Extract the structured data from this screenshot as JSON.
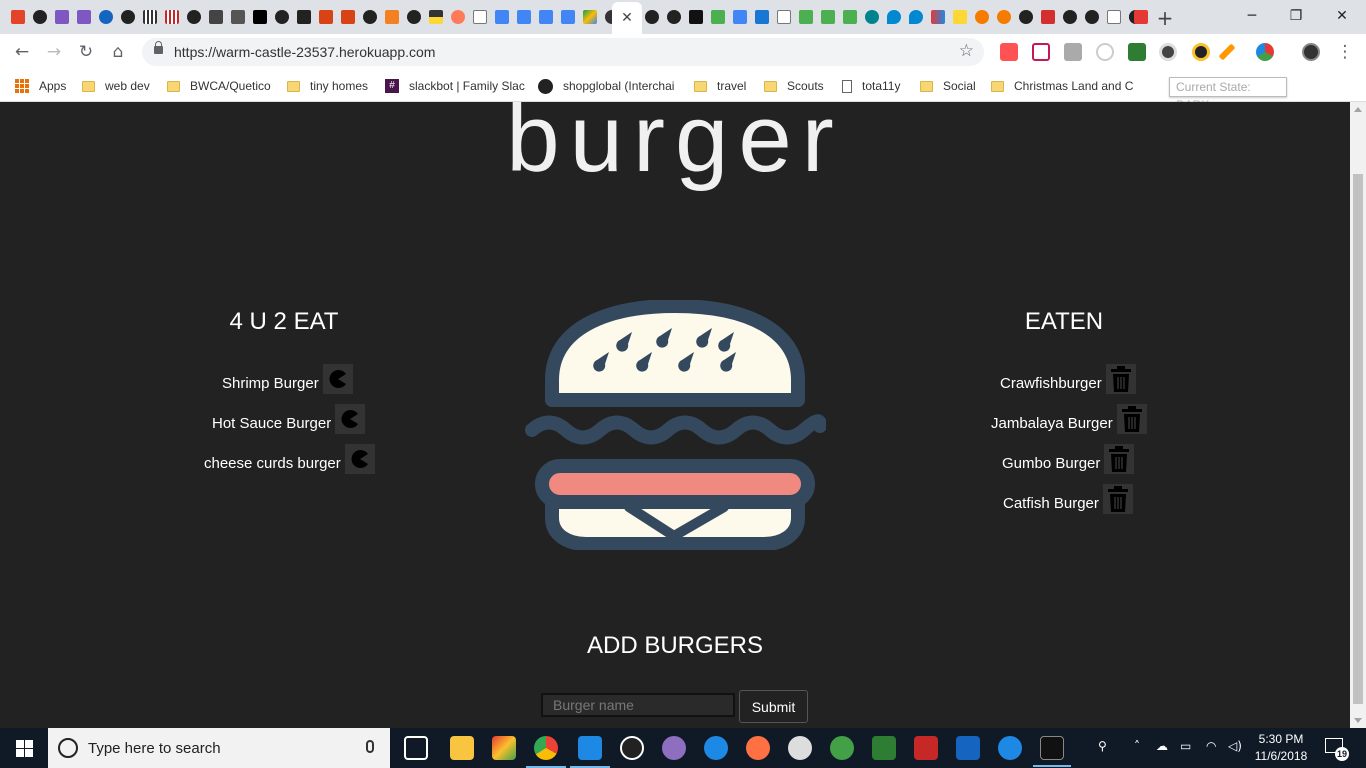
{
  "browser": {
    "url": "https://warm-castle-23537.herokuapp.com",
    "tooltip": "Current State: DARK",
    "bookmarks": [
      {
        "label": "Apps",
        "icon": "apps-icon"
      },
      {
        "label": "web dev",
        "icon": "folder-icon"
      },
      {
        "label": "BWCA/Quetico",
        "icon": "folder-icon"
      },
      {
        "label": "tiny homes",
        "icon": "folder-icon"
      },
      {
        "label": "slackbot | Family Slac",
        "icon": "slack-icon"
      },
      {
        "label": "shopglobal (Interchai",
        "icon": "github-icon"
      },
      {
        "label": "travel",
        "icon": "folder-icon"
      },
      {
        "label": "Scouts",
        "icon": "folder-icon"
      },
      {
        "label": "tota11y",
        "icon": "page-icon"
      },
      {
        "label": "Social",
        "icon": "folder-icon"
      },
      {
        "label": "Christmas Land and C",
        "icon": "folder-icon"
      }
    ]
  },
  "page": {
    "title": "burger",
    "to_eat": {
      "heading": "4 U 2 EAT",
      "items": [
        "Shrimp Burger",
        "Hot Sauce Burger",
        "cheese curds burger"
      ]
    },
    "eaten": {
      "heading": "EATEN",
      "items": [
        "Crawfishburger",
        "Jambalaya Burger",
        "Gumbo Burger",
        "Catfish Burger"
      ]
    },
    "add": {
      "heading": "ADD BURGERS",
      "placeholder": "Burger name",
      "submit_label": "Submit"
    }
  },
  "taskbar": {
    "search_text": "Type here to search",
    "time": "5:30 PM",
    "date": "11/6/2018",
    "notifications": "19"
  },
  "colors": {
    "page_bg": "#222222",
    "burger_outline": "#34495e",
    "bun": "#fdfaec",
    "sauce": "#f08a80"
  }
}
